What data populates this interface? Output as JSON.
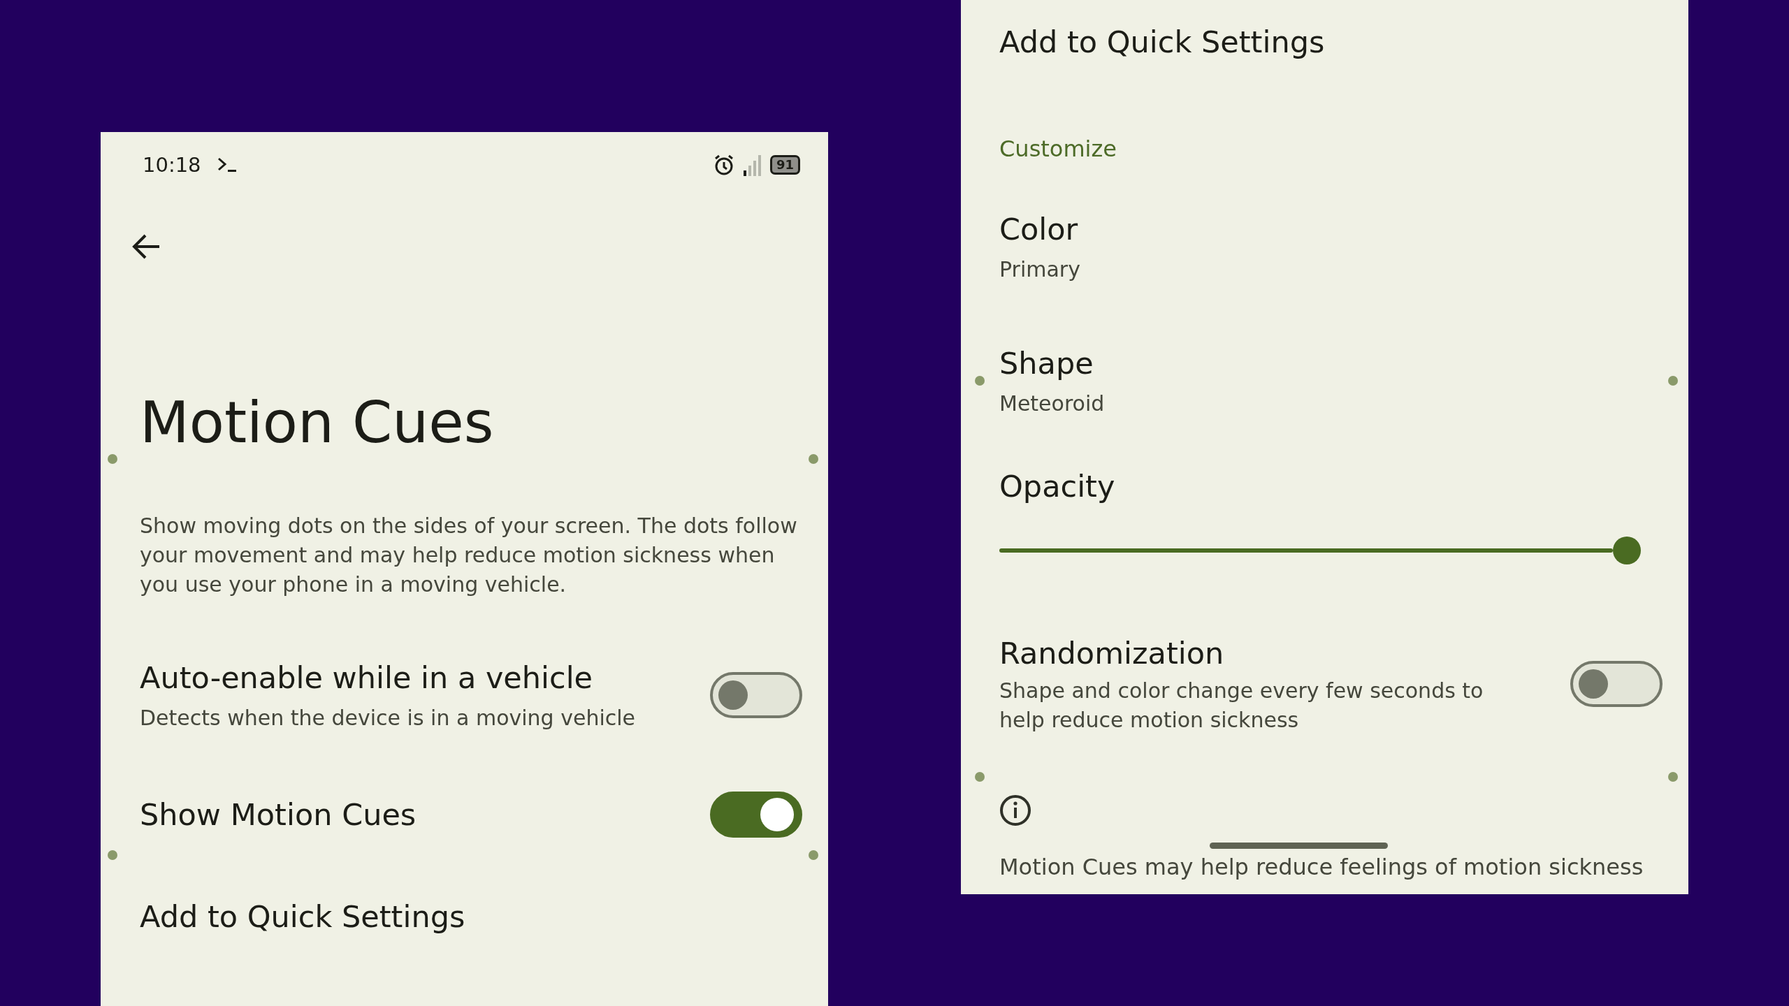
{
  "status_bar": {
    "time": "10:18",
    "battery": "91"
  },
  "left": {
    "title": "Motion Cues",
    "description": "Show moving dots on the sides of your screen. The dots follow your movement and may help reduce motion sickness when you use your phone in a moving vehicle.",
    "settings": [
      {
        "kind": "toggle",
        "title": "Auto-enable while in a vehicle",
        "subtitle": "Detects when the device is in a moving vehicle",
        "on": false
      },
      {
        "kind": "toggle",
        "title": "Show Motion Cues",
        "on": true
      },
      {
        "kind": "link",
        "title": "Add to Quick Settings"
      }
    ]
  },
  "right": {
    "items": [
      {
        "kind": "link",
        "title": "Add to Quick Settings"
      },
      {
        "kind": "header",
        "title": "Customize"
      },
      {
        "kind": "value",
        "title": "Color",
        "subtitle": "Primary"
      },
      {
        "kind": "value",
        "title": "Shape",
        "subtitle": "Meteoroid"
      },
      {
        "kind": "slider",
        "title": "Opacity",
        "level": 1.0
      },
      {
        "kind": "toggle",
        "title": "Randomization",
        "subtitle": "Shape and color change every few seconds to help reduce motion sickness",
        "on": false
      }
    ],
    "footer": "Motion Cues may help reduce feelings of motion sickness"
  }
}
